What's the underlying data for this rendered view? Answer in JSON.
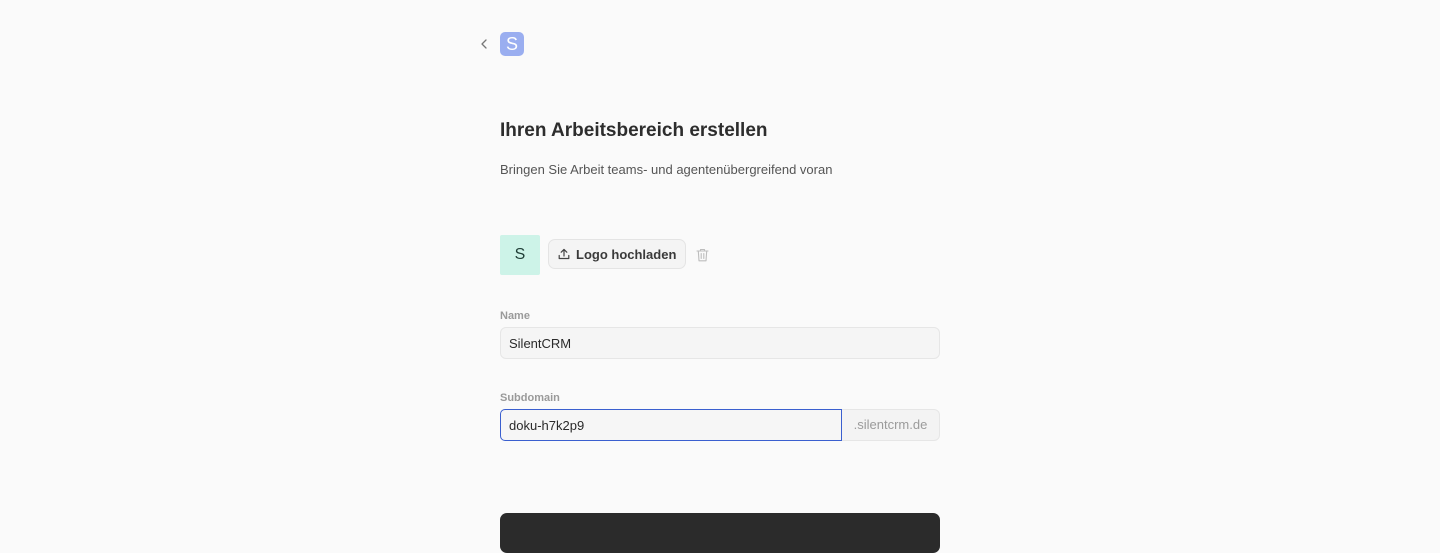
{
  "header": {
    "back_icon": "chevron-left-icon",
    "app_logo_letter": "S",
    "app_logo_color": "#9aaef0"
  },
  "main": {
    "title": "Ihren Arbeitsbereich erstellen",
    "subtitle": "Bringen Sie Arbeit teams- und agentenübergreifend voran"
  },
  "logo_section": {
    "avatar_letter": "S",
    "avatar_color": "#cdf3e8",
    "upload_label": "Logo hochladen",
    "upload_icon": "upload-icon",
    "delete_icon": "trash-icon"
  },
  "form": {
    "name_label": "Name",
    "name_value": "SilentCRM",
    "subdomain_label": "Subdomain",
    "subdomain_value": "doku-h7k2p9",
    "subdomain_suffix": ".silentcrm.de",
    "focus_color": "#3a5fcf"
  }
}
